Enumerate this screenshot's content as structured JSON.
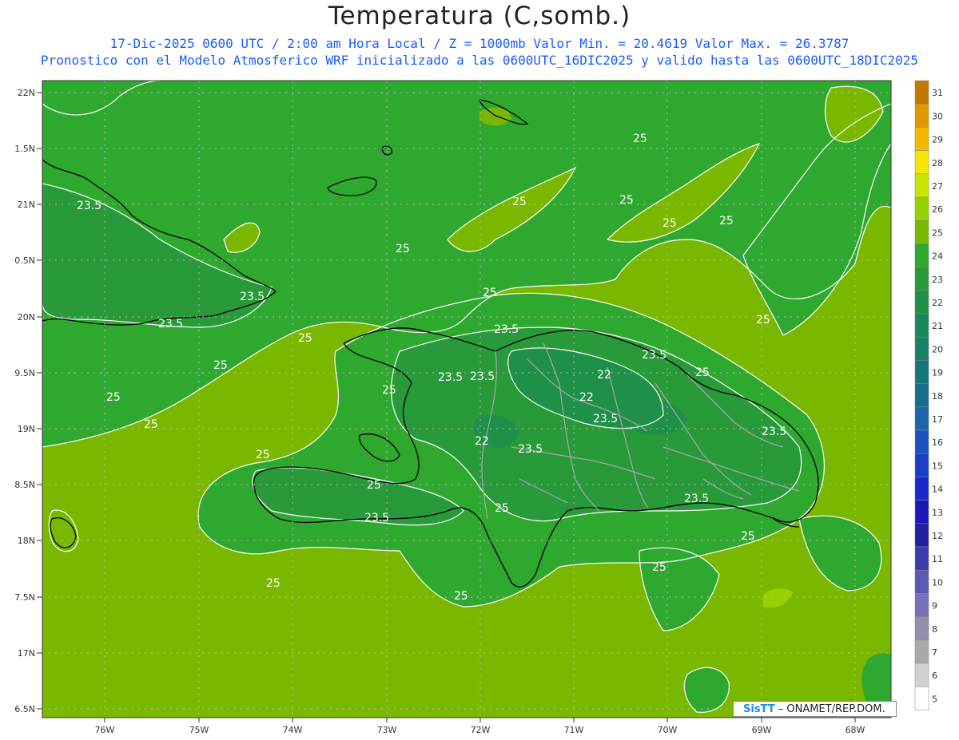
{
  "header": {
    "title": "Temperatura (C,somb.)",
    "subtitle1": "17-Dic-2025  0600 UTC / 2:00 am Hora Local / Z = 1000mb   Valor Min. = 20.4619  Valor Max. = 26.3787",
    "subtitle2": "Pronostico con el Modelo Atmosferico WRF inicializado a las 0600UTC_16DIC2025 y valido hasta las  0600UTC_18DIC2025"
  },
  "axes": {
    "lat_labels": [
      "22N",
      "1.5N",
      "21N",
      "0.5N",
      "20N",
      "9.5N",
      "19N",
      "8.5N",
      "18N",
      "7.5N",
      "17N",
      "6.5N"
    ],
    "lon_labels": [
      "76W",
      "75W",
      "74W",
      "73W",
      "72W",
      "71W",
      "70W",
      "69W",
      "68W"
    ]
  },
  "colorbar": {
    "labels": [
      "31",
      "30",
      "29",
      "28",
      "27",
      "26",
      "25",
      "24",
      "23",
      "22",
      "21",
      "20",
      "19",
      "18",
      "17",
      "16",
      "15",
      "14",
      "13",
      "12",
      "11",
      "10",
      "9",
      "8",
      "7",
      "6",
      "5"
    ],
    "colors": [
      "#c07800",
      "#e09a00",
      "#f5b800",
      "#f5e600",
      "#c8e600",
      "#96d200",
      "#7ab800",
      "#2fa82f",
      "#289a3a",
      "#1f9048",
      "#1a8858",
      "#168066",
      "#147878",
      "#156e8a",
      "#1a66a8",
      "#1a52c0",
      "#1a3ec8",
      "#1a2ac8",
      "#1a18b8",
      "#2020a0",
      "#3c3caa",
      "#5a5ab4",
      "#7870b8",
      "#9090a8",
      "#aaaaaa",
      "#d2d2d2",
      "#ffffff"
    ]
  },
  "contour_labels": [
    {
      "text": "23.5"
    },
    {
      "text": "25"
    },
    {
      "text": "23.5"
    },
    {
      "text": "23.5"
    },
    {
      "text": "25"
    },
    {
      "text": "25"
    },
    {
      "text": "25"
    },
    {
      "text": "25"
    },
    {
      "text": "25"
    },
    {
      "text": "25"
    },
    {
      "text": "25"
    },
    {
      "text": "25"
    },
    {
      "text": "25"
    },
    {
      "text": "23.5"
    },
    {
      "text": "22"
    },
    {
      "text": "23.5"
    },
    {
      "text": "23.5"
    },
    {
      "text": "22"
    },
    {
      "text": "23.5"
    },
    {
      "text": "23.5"
    },
    {
      "text": "22"
    },
    {
      "text": "23.5"
    },
    {
      "text": "25"
    },
    {
      "text": "25"
    },
    {
      "text": "23.5"
    },
    {
      "text": "23.5"
    },
    {
      "text": "25"
    },
    {
      "text": "23.5"
    },
    {
      "text": "25"
    },
    {
      "text": "25"
    },
    {
      "text": "25"
    },
    {
      "text": "25"
    },
    {
      "text": "25"
    },
    {
      "text": "25"
    },
    {
      "text": "25"
    },
    {
      "text": "25"
    }
  ],
  "footer": {
    "brand": "SisTT",
    "credit": "– ONAMET/REP.DOM."
  }
}
